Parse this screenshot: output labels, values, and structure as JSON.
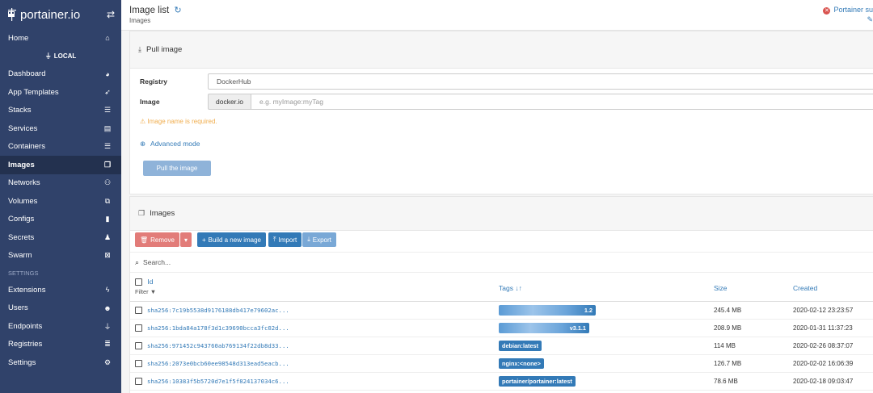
{
  "brand": {
    "name": "portainer.io",
    "toggle_icon": "exchange-icon"
  },
  "sidebar": {
    "home_label": "Home",
    "environment_label": "LOCAL",
    "items": [
      {
        "label": "Dashboard",
        "icon": "tachometer-icon",
        "glyph": "◕"
      },
      {
        "label": "App Templates",
        "icon": "rocket-icon",
        "glyph": "➶"
      },
      {
        "label": "Stacks",
        "icon": "list-icon",
        "glyph": "☰"
      },
      {
        "label": "Services",
        "icon": "services-list-icon",
        "glyph": "▤"
      },
      {
        "label": "Containers",
        "icon": "server-icon",
        "glyph": "☰"
      },
      {
        "label": "Images",
        "icon": "clone-icon",
        "glyph": "❐",
        "active": true
      },
      {
        "label": "Networks",
        "icon": "sitemap-icon",
        "glyph": "⚇"
      },
      {
        "label": "Volumes",
        "icon": "cubes-icon",
        "glyph": "⧉"
      },
      {
        "label": "Configs",
        "icon": "file-icon",
        "glyph": "▮"
      },
      {
        "label": "Secrets",
        "icon": "user-secret-icon",
        "glyph": "♟"
      },
      {
        "label": "Swarm",
        "icon": "swarm-icon",
        "glyph": "⊠"
      }
    ],
    "settings_section_label": "SETTINGS",
    "settings_items": [
      {
        "label": "Extensions",
        "icon": "bolt-icon",
        "glyph": "ϟ"
      },
      {
        "label": "Users",
        "icon": "users-icon",
        "glyph": "☻"
      },
      {
        "label": "Endpoints",
        "icon": "plug-icon",
        "glyph": "⏚"
      },
      {
        "label": "Registries",
        "icon": "database-icon",
        "glyph": "≣"
      },
      {
        "label": "Settings",
        "icon": "cogs-icon",
        "glyph": "⚙"
      }
    ]
  },
  "header": {
    "title": "Image list",
    "breadcrumb": "Images",
    "status_text": "Portainer su"
  },
  "pull_panel": {
    "title": "Pull image",
    "registry_label": "Registry",
    "registry_value": "DockerHub",
    "image_label": "Image",
    "image_prefix": "docker.io",
    "image_placeholder": "e.g. myImage:myTag",
    "warning": "Image name is required.",
    "advanced_link": "Advanced mode",
    "pull_button": "Pull the image"
  },
  "images_panel": {
    "title": "Images",
    "remove_button": "Remove",
    "build_button": "Build a new image",
    "import_button": "Import",
    "export_button": "Export",
    "search_placeholder": "Search...",
    "columns": {
      "id": "Id",
      "filter": "Filter",
      "tags": "Tags",
      "size": "Size",
      "created": "Created"
    },
    "rows": [
      {
        "id": "sha256:7c19b5538d9176188db417e79602ac...",
        "tag": "1.2",
        "tag_obscured": true,
        "size": "245.4 MB",
        "created": "2020-02-12 23:23:57"
      },
      {
        "id": "sha256:1bda84a178f3d1c39690bcca3fc02d...",
        "tag": "v3.1.1",
        "tag_obscured": true,
        "size": "208.9 MB",
        "created": "2020-01-31 11:37:23"
      },
      {
        "id": "sha256:971452c943760ab769134f22db8d33...",
        "tag": "debian:latest",
        "tag_obscured": false,
        "size": "114 MB",
        "created": "2020-02-26 08:37:07"
      },
      {
        "id": "sha256:2073e0bcb60ee98548d313ead5eacb...",
        "tag": "nginx:<none>",
        "tag_obscured": false,
        "size": "126.7 MB",
        "created": "2020-02-02 16:06:39"
      },
      {
        "id": "sha256:10383f5b5720d7e1f5f824137034c6...",
        "tag": "portainer/portainer:latest",
        "tag_obscured": false,
        "size": "78.6 MB",
        "created": "2020-02-18 09:03:47"
      }
    ]
  },
  "colors": {
    "sidebar": "#30426a",
    "primary": "#337ab7",
    "danger": "#e27c79",
    "warning": "#f0ad4e"
  }
}
